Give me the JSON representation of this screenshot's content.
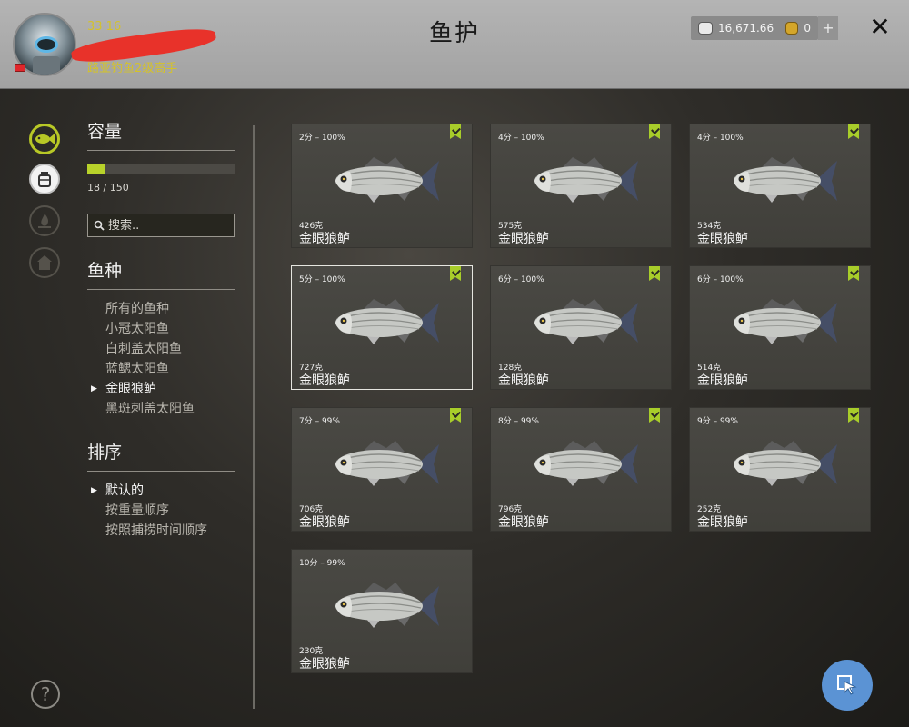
{
  "header": {
    "title": "鱼护",
    "stats_text": "33 16",
    "rank_text": "路亚钓鱼2级高手",
    "silver_amount": "16,671.66",
    "gold_amount": "0",
    "plus_label": "+",
    "close_label": "✕"
  },
  "icons": {
    "nav": [
      "fish-icon",
      "backpack-icon",
      "campfire-icon",
      "home-icon"
    ],
    "help": "?"
  },
  "capacity": {
    "title": "容量",
    "text": "18 / 150",
    "fill_fraction": 0.12
  },
  "search": {
    "placeholder": "搜索..",
    "value": ""
  },
  "species": {
    "title": "鱼种",
    "items": [
      "所有的鱼种",
      "小冠太阳鱼",
      "白刺盖太阳鱼",
      "蓝鳃太阳鱼",
      "金眼狼鲈",
      "黑斑刺盖太阳鱼"
    ],
    "selected_index": 4
  },
  "sort": {
    "title": "排序",
    "items": [
      "默认的",
      "按重量顺序",
      "按照捕捞时间顺序"
    ],
    "selected_index": 0
  },
  "fish_cards": [
    {
      "score": "2分 – 100%",
      "weight": "426克",
      "name": "金眼狼鲈",
      "bookmarked": true
    },
    {
      "score": "4分 – 100%",
      "weight": "575克",
      "name": "金眼狼鲈",
      "bookmarked": true
    },
    {
      "score": "4分 – 100%",
      "weight": "534克",
      "name": "金眼狼鲈",
      "bookmarked": true
    },
    {
      "score": "5分 – 100%",
      "weight": "727克",
      "name": "金眼狼鲈",
      "bookmarked": true
    },
    {
      "score": "6分 – 100%",
      "weight": "128克",
      "name": "金眼狼鲈",
      "bookmarked": true
    },
    {
      "score": "6分 – 100%",
      "weight": "514克",
      "name": "金眼狼鲈",
      "bookmarked": true
    },
    {
      "score": "7分 – 99%",
      "weight": "706克",
      "name": "金眼狼鲈",
      "bookmarked": true
    },
    {
      "score": "8分 – 99%",
      "weight": "796克",
      "name": "金眼狼鲈",
      "bookmarked": true
    },
    {
      "score": "9分 – 99%",
      "weight": "252克",
      "name": "金眼狼鲈",
      "bookmarked": true
    },
    {
      "score": "10分 – 99%",
      "weight": "230克",
      "name": "金眼狼鲈",
      "bookmarked": false
    }
  ],
  "colors": {
    "accent": "#b8d22a",
    "topbar": "#aaaaaa",
    "cursor_button": "#5b93d4"
  }
}
